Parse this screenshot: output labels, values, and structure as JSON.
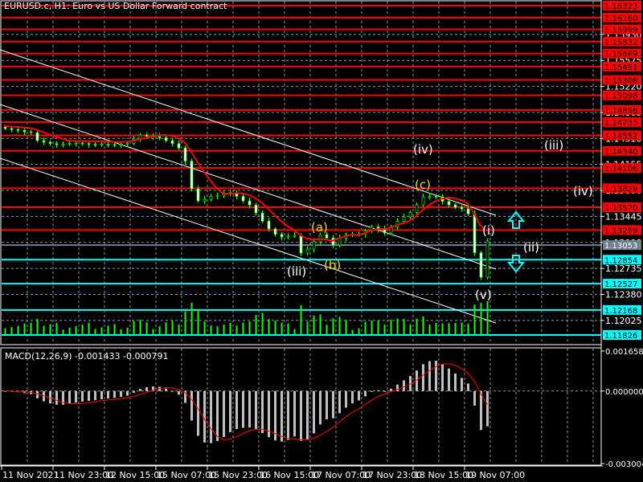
{
  "header": {
    "title": "EURUSD.c, H1:  Euro vs US Dollar Forward contract"
  },
  "colors": {
    "background": "#000000",
    "resistance": "#ff0000",
    "support": "#00ffff",
    "current": "#708090",
    "bull": "#00ff00",
    "grid": "#8899aa"
  },
  "chart_data": {
    "type": "candlestick",
    "symbol": "EURUSD.c",
    "timeframe": "H1",
    "ylim": [
      1.11826,
      1.16323
    ],
    "y_ticks": [
      "1.15930",
      "1.15575",
      "1.15220",
      "1.14865",
      "1.14510",
      "1.14155",
      "1.13800",
      "1.13445",
      "1.13090",
      "1.12735",
      "1.12380",
      "1.12025"
    ],
    "x_ticks": [
      "11 Nov 2021",
      "11 Nov 23:00",
      "12 Nov 15:00",
      "15 Nov 07:00",
      "15 Nov 23:00",
      "16 Nov 15:00",
      "17 Nov 07:00",
      "17 Nov 23:00",
      "18 Nov 15:00",
      "19 Nov 07:00"
    ],
    "close": [
      1.14645,
      1.1463,
      1.1462,
      1.146,
      1.1459,
      1.1448,
      1.1446,
      1.1444,
      1.14425,
      1.1443,
      1.1444,
      1.14447,
      1.1444,
      1.1443,
      1.14425,
      1.1443,
      1.14425,
      1.1442,
      1.1443,
      1.1444,
      1.145,
      1.14557,
      1.1454,
      1.14535,
      1.1452,
      1.1448,
      1.1444,
      1.1438,
      1.142,
      1.13822,
      1.13657,
      1.1368,
      1.1372,
      1.13734,
      1.1375,
      1.13767,
      1.1372,
      1.13657,
      1.136,
      1.13493,
      1.1338,
      1.13274,
      1.132,
      1.13164,
      1.13175,
      1.13186,
      1.12944,
      1.12999,
      1.131,
      1.13197,
      1.1315,
      1.13054,
      1.1315,
      1.13197,
      1.132,
      1.13197,
      1.1325,
      1.133,
      1.1327,
      1.13219,
      1.133,
      1.1338,
      1.13438,
      1.135,
      1.13603,
      1.13712,
      1.1372,
      1.13712,
      1.1365,
      1.13603,
      1.1357,
      1.13548,
      1.1348,
      1.1295,
      1.12615,
      1.13109
    ],
    "resistance_levels": [
      "1.16323",
      "1.16160",
      "1.15999",
      "1.15832",
      "1.15669",
      "1.15491",
      "1.15308",
      "1.15098",
      "1.14898",
      "1.14733",
      "1.14552",
      "1.14340",
      "1.14106",
      "1.13829",
      "1.13570",
      "1.13259"
    ],
    "current_price": "1.13053",
    "support_levels": [
      "1.12854",
      "1.12527",
      "1.12168",
      "1.11826"
    ],
    "wave_labels": {
      "iv_a": "(iv)",
      "iii_a": "(iii)",
      "iv_b": "(iv)",
      "c": "(c)",
      "a": "(a)",
      "b": "(b)",
      "iii_b": "(iii)",
      "i": "(i)",
      "ii": "(ii)",
      "v": "(v)"
    },
    "macd": {
      "label": "MACD(12,26,9) -0.001433 -0.000791",
      "ylim": [
        -0.003004,
        0.001658
      ],
      "y_ticks": [
        "0.001658",
        "0.000000",
        "-0.003004"
      ]
    }
  }
}
